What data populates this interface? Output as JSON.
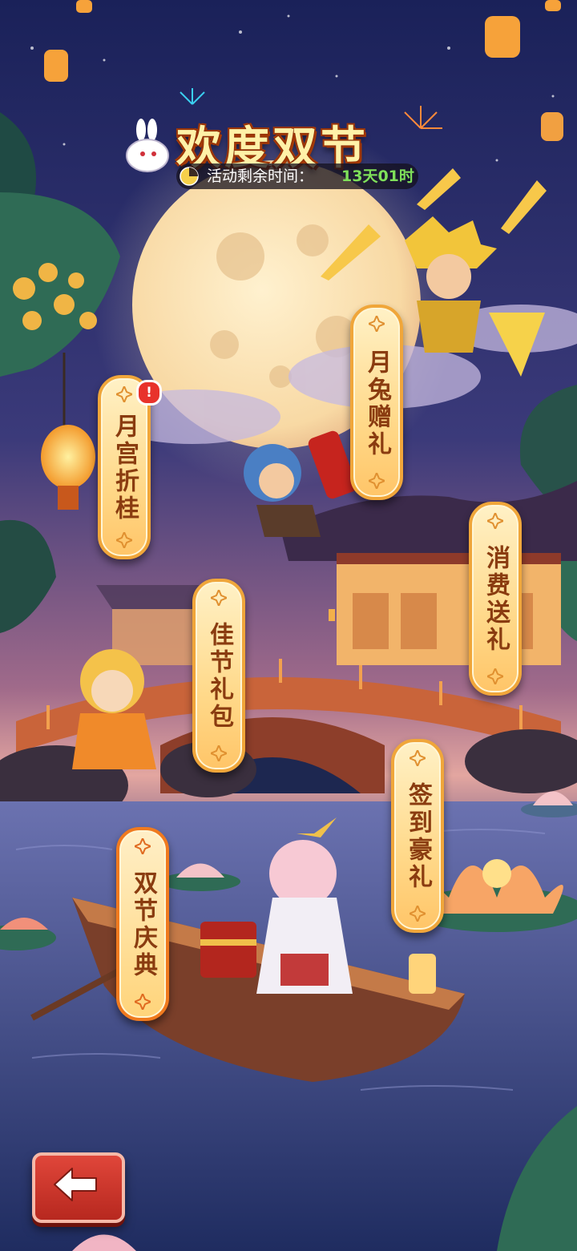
{
  "event": {
    "title": "欢度双节",
    "timer_label": "活动剩余时间：",
    "timer_value": "13天01时"
  },
  "menu": [
    {
      "id": "moon-palace",
      "label": "月宫折桂",
      "has_alert": true,
      "alert_text": "!"
    },
    {
      "id": "rabbit-gift",
      "label": "月兔赠礼"
    },
    {
      "id": "spend-reward",
      "label": "消费送礼"
    },
    {
      "id": "festival-pack",
      "label": "佳节礼包"
    },
    {
      "id": "checkin-gift",
      "label": "签到豪礼"
    },
    {
      "id": "double-celebration",
      "label": "双节庆典"
    }
  ],
  "buttons": {
    "back_icon": "arrow-left-icon"
  },
  "colors": {
    "sky_top": "#1a2159",
    "sky_mid": "#5d4a8d",
    "moon": "#fbe3b8",
    "banner_fill": "#ffd98a",
    "banner_border": "#f0a63a",
    "banner_text": "#8a3c10",
    "timer_value": "#7fe05a",
    "back_button": "#d23a2e"
  }
}
